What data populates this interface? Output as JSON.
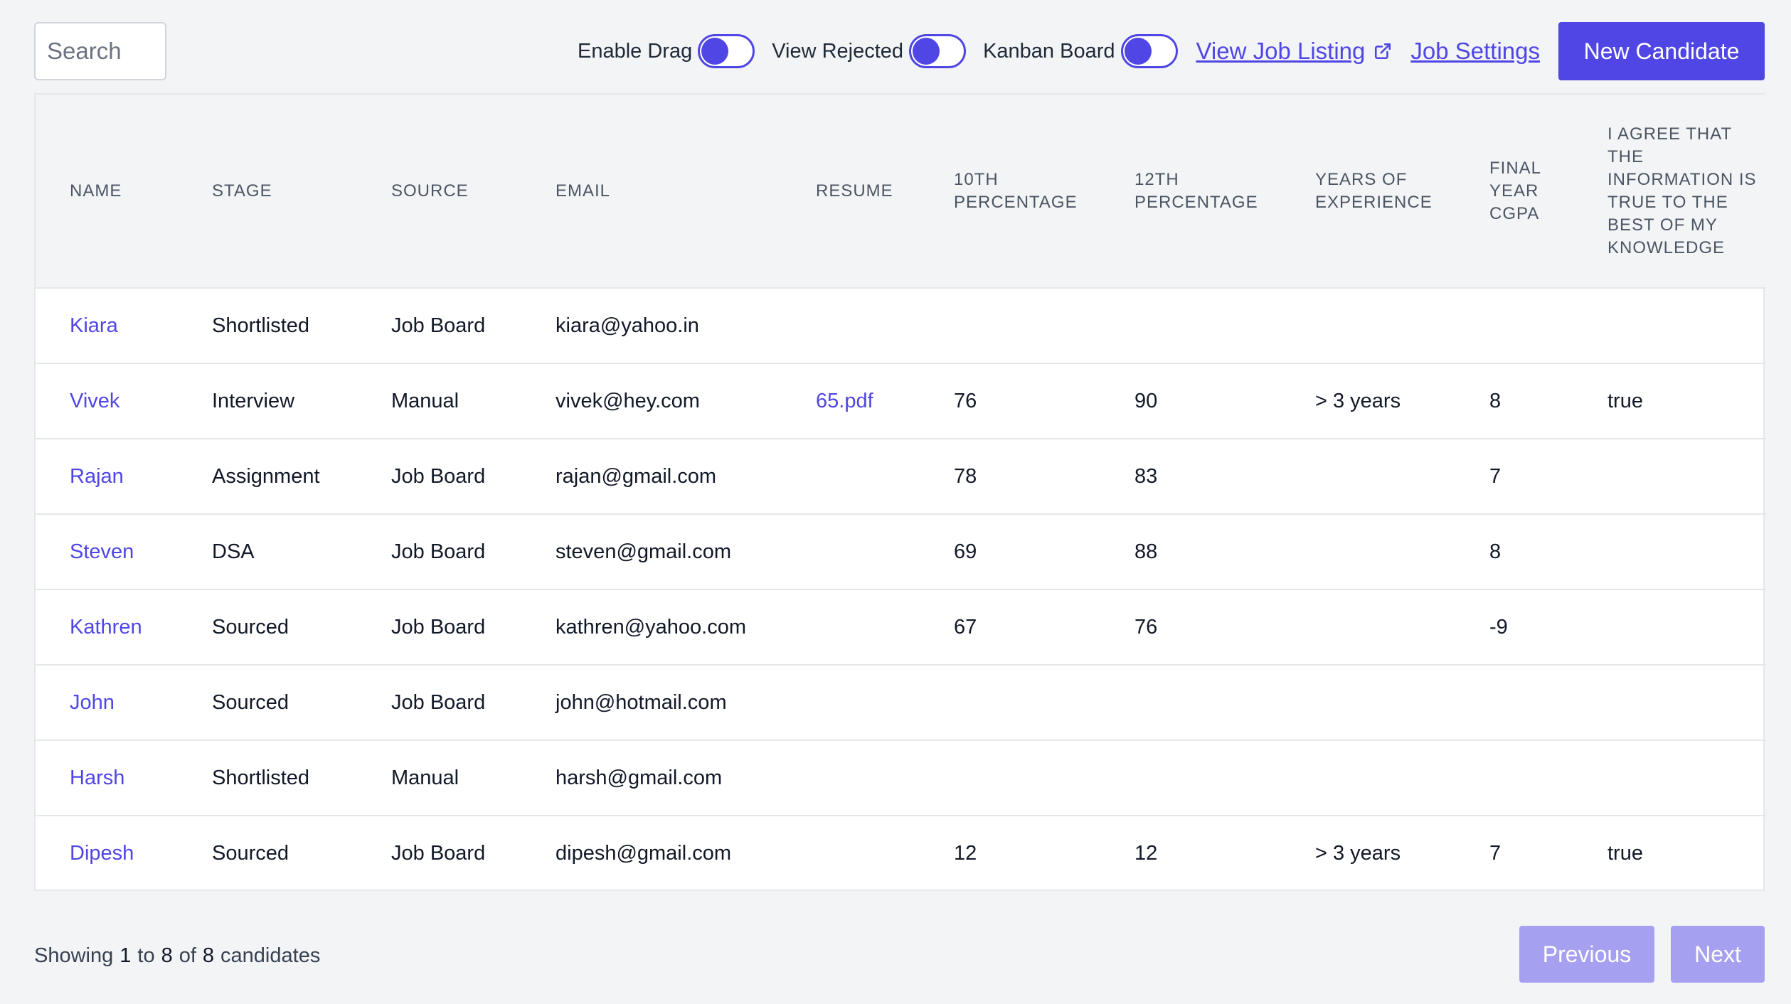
{
  "toolbar": {
    "search_placeholder": "Search",
    "toggles": [
      {
        "label": "Enable Drag",
        "on": false
      },
      {
        "label": "View Rejected",
        "on": false
      },
      {
        "label": "Kanban Board",
        "on": false
      }
    ],
    "view_job_listing": "View Job Listing",
    "job_settings": "Job Settings",
    "new_candidate": "New Candidate",
    "accent_color": "#4f46e5",
    "icons": {
      "external_link": "external-link-icon"
    }
  },
  "table": {
    "columns": [
      "Name",
      "Stage",
      "Source",
      "Email",
      "Resume",
      "10th Percentage",
      "12th Percentage",
      "Years of Experience",
      "Final Year CGPA",
      "I agree that the information is true to the best of my knowledge"
    ],
    "rows": [
      {
        "name": "Kiara",
        "stage": "Shortlisted",
        "source": "Job Board",
        "email": "kiara@yahoo.in",
        "resume": "",
        "p10": "",
        "p12": "",
        "experience": "",
        "cgpa": "",
        "agree": ""
      },
      {
        "name": "Vivek",
        "stage": "Interview",
        "source": "Manual",
        "email": "vivek@hey.com",
        "resume": "65.pdf",
        "p10": "76",
        "p12": "90",
        "experience": "> 3 years",
        "cgpa": "8",
        "agree": "true"
      },
      {
        "name": "Rajan",
        "stage": "Assignment",
        "source": "Job Board",
        "email": "rajan@gmail.com",
        "resume": "",
        "p10": "78",
        "p12": "83",
        "experience": "",
        "cgpa": "7",
        "agree": ""
      },
      {
        "name": "Steven",
        "stage": "DSA",
        "source": "Job Board",
        "email": "steven@gmail.com",
        "resume": "",
        "p10": "69",
        "p12": "88",
        "experience": "",
        "cgpa": "8",
        "agree": ""
      },
      {
        "name": "Kathren",
        "stage": "Sourced",
        "source": "Job Board",
        "email": "kathren@yahoo.com",
        "resume": "",
        "p10": "67",
        "p12": "76",
        "experience": "",
        "cgpa": "-9",
        "agree": ""
      },
      {
        "name": "John",
        "stage": "Sourced",
        "source": "Job Board",
        "email": "john@hotmail.com",
        "resume": "",
        "p10": "",
        "p12": "",
        "experience": "",
        "cgpa": "",
        "agree": ""
      },
      {
        "name": "Harsh",
        "stage": "Shortlisted",
        "source": "Manual",
        "email": "harsh@gmail.com",
        "resume": "",
        "p10": "",
        "p12": "",
        "experience": "",
        "cgpa": "",
        "agree": ""
      },
      {
        "name": "Dipesh",
        "stage": "Sourced",
        "source": "Job Board",
        "email": "dipesh@gmail.com",
        "resume": "",
        "p10": "12",
        "p12": "12",
        "experience": "> 3 years",
        "cgpa": "7",
        "agree": "true"
      }
    ]
  },
  "footer": {
    "showing": "Showing",
    "from": "1",
    "to_word": "to",
    "to": "8",
    "of_word": "of",
    "total": "8",
    "suffix": "candidates",
    "previous": "Previous",
    "next": "Next"
  }
}
